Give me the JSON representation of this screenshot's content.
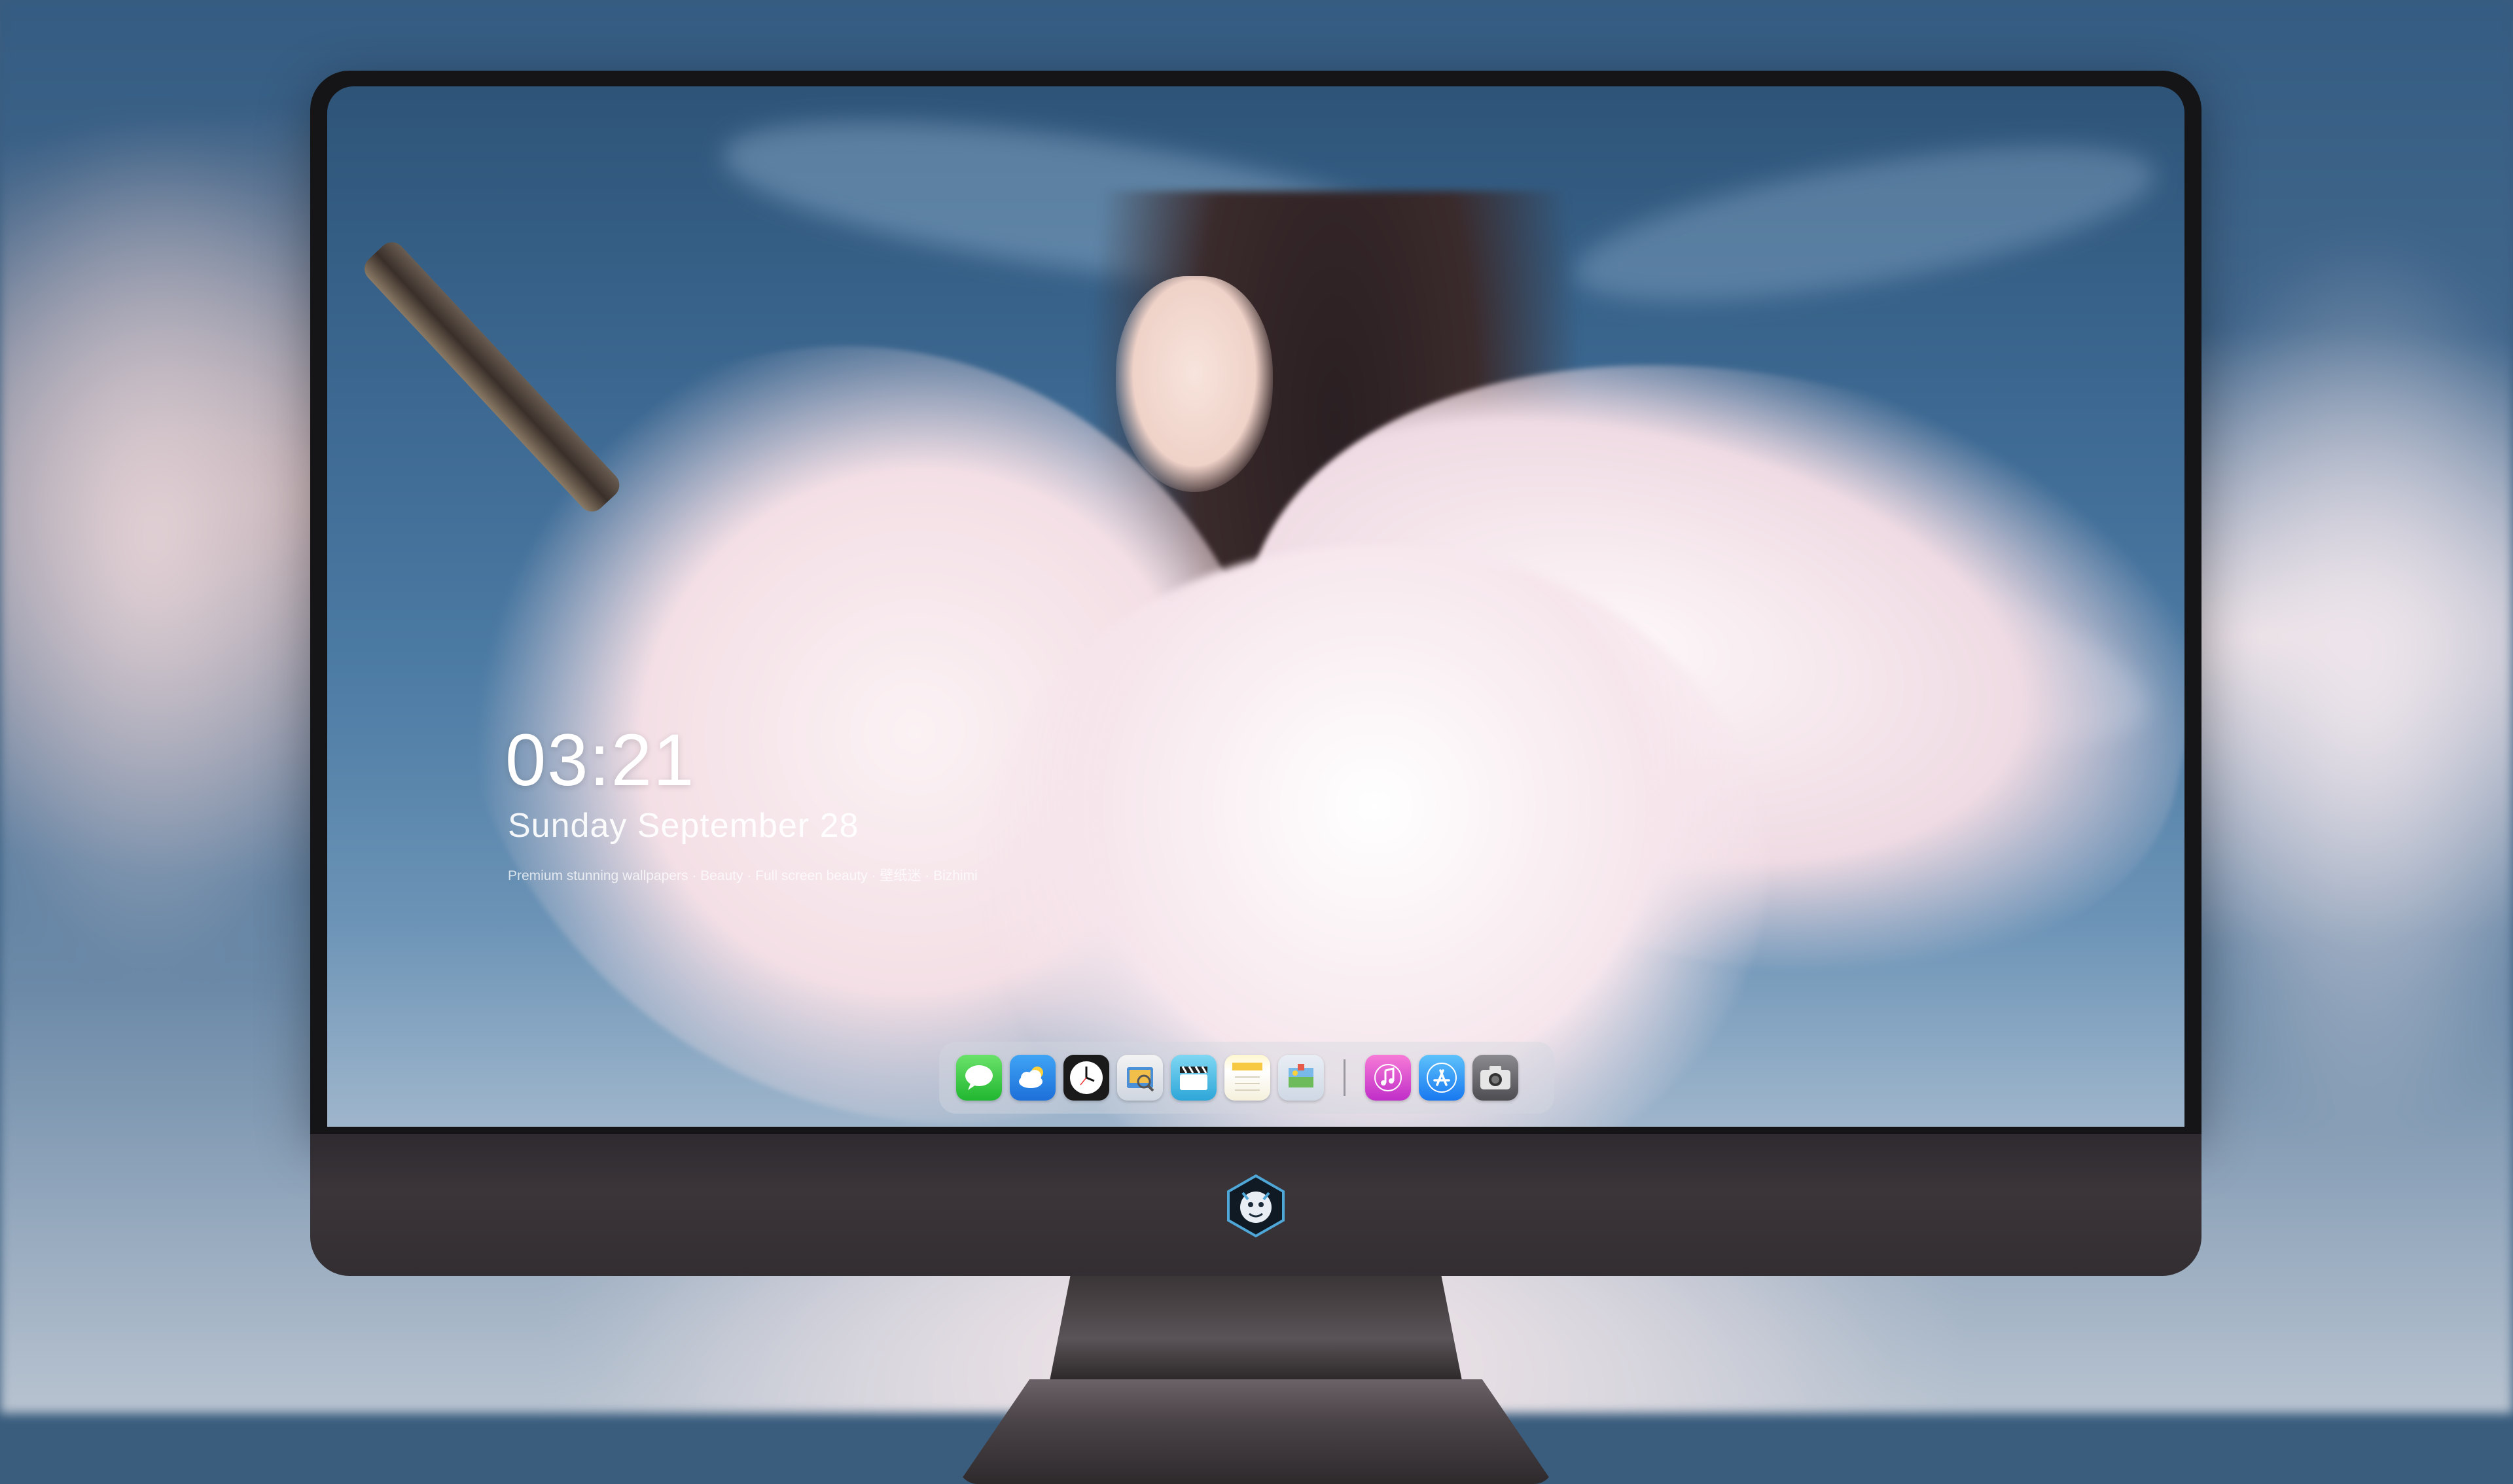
{
  "lock_screen": {
    "time": "03:21",
    "date": "Sunday September  28",
    "caption": "Premium stunning wallpapers · Beauty · Full screen beauty · 壁纸迷 · Bizhimi"
  },
  "dock": {
    "apps": [
      {
        "name": "Messages",
        "icon": "message-bubble-icon"
      },
      {
        "name": "Weather",
        "icon": "cloud-sun-icon"
      },
      {
        "name": "Clock",
        "icon": "clock-icon"
      },
      {
        "name": "Preview",
        "icon": "preview-icon"
      },
      {
        "name": "Claquette",
        "icon": "clapperboard-icon"
      },
      {
        "name": "Notes",
        "icon": "notes-icon"
      },
      {
        "name": "Photos",
        "icon": "photos-icon"
      },
      {
        "name": "Music",
        "icon": "music-note-icon"
      },
      {
        "name": "App Store",
        "icon": "app-store-icon"
      },
      {
        "name": "Camera",
        "icon": "camera-icon"
      }
    ]
  },
  "colors": {
    "bezel": "#151517",
    "chin": "#3b3539",
    "sky": "#3c6891",
    "robe": "#f6e6ec"
  }
}
